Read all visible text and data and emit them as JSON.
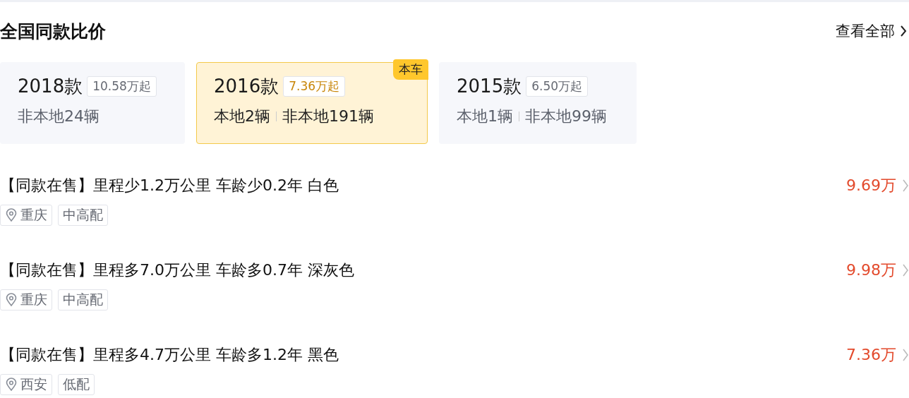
{
  "header": {
    "title": "全国同款比价",
    "link": "查看全部"
  },
  "cards": [
    {
      "year": "2018款",
      "price": "10.58万起",
      "counts": [
        "非本地24辆"
      ],
      "selected": false
    },
    {
      "year": "2016款",
      "price": "7.36万起",
      "counts": [
        "本地2辆",
        "非本地191辆"
      ],
      "selected": true,
      "badge": "本车"
    },
    {
      "year": "2015款",
      "price": "6.50万起",
      "counts": [
        "本地1辆",
        "非本地99辆"
      ],
      "selected": false
    }
  ],
  "listings": [
    {
      "title": "【同款在售】里程少1.2万公里 车龄少0.2年 白色",
      "price": "9.69万",
      "tags": [
        {
          "kind": "location",
          "text": "重庆"
        },
        {
          "kind": "trim",
          "text": "中高配"
        }
      ]
    },
    {
      "title": "【同款在售】里程多7.0万公里 车龄多0.7年 深灰色",
      "price": "9.98万",
      "tags": [
        {
          "kind": "location",
          "text": "重庆"
        },
        {
          "kind": "trim",
          "text": "中高配"
        }
      ]
    },
    {
      "title": "【同款在售】里程多4.7万公里 车龄多1.2年 黑色",
      "price": "7.36万",
      "tags": [
        {
          "kind": "location",
          "text": "西安"
        },
        {
          "kind": "trim",
          "text": "低配"
        }
      ]
    }
  ]
}
